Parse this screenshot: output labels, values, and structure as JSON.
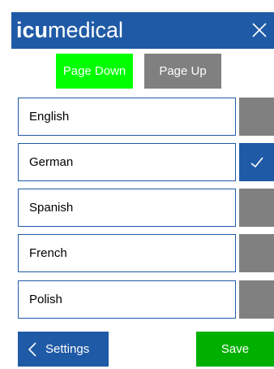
{
  "header": {
    "logo_bold": "icu",
    "logo_light": "medical",
    "close_icon": "close-icon"
  },
  "paging": {
    "page_down_label": "Page Down",
    "page_up_label": "Page Up"
  },
  "languages": [
    {
      "label": "English",
      "selected": false
    },
    {
      "label": "German",
      "selected": true
    },
    {
      "label": "Spanish",
      "selected": false
    },
    {
      "label": "French",
      "selected": false
    },
    {
      "label": "Polish",
      "selected": false
    }
  ],
  "footer": {
    "settings_label": "Settings",
    "save_label": "Save"
  },
  "colors": {
    "header_blue": "#1f5aa6",
    "page_down_green": "#00ff00",
    "save_green": "#00b000",
    "unchecked_gray": "#808080"
  }
}
